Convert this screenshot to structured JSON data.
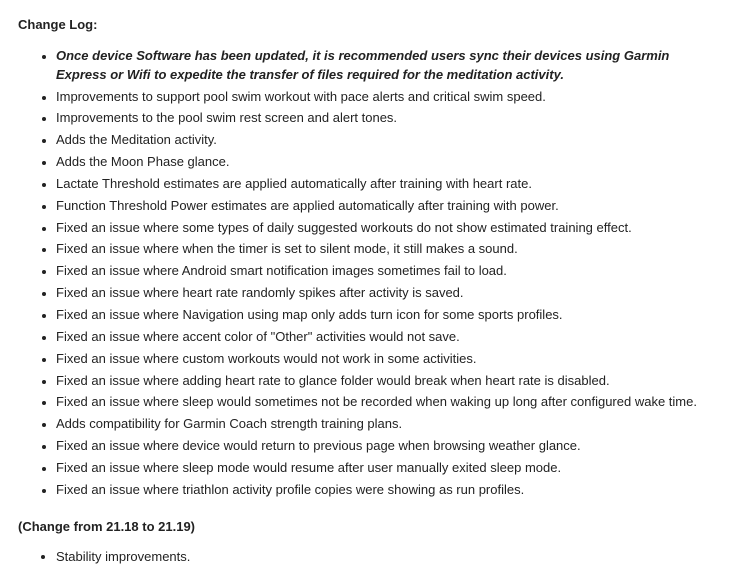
{
  "heading": "Change Log:",
  "items": [
    "Once device Software has been updated, it is recommended users sync their devices using Garmin Express or Wifi to expedite the transfer of files required for the meditation activity.",
    "Improvements to support pool swim workout with pace alerts and critical swim speed.",
    "Improvements to the pool swim rest screen and alert tones.",
    "Adds the Meditation activity.",
    "Adds the Moon Phase glance.",
    "Lactate Threshold estimates are applied automatically after training with heart rate.",
    "Function Threshold Power estimates are applied automatically after training with power.",
    "Fixed an issue where some types of daily suggested workouts do not show estimated training effect.",
    "Fixed an issue where when the timer is set to silent mode, it still makes a sound.",
    "Fixed an issue where Android smart notification images sometimes fail to load.",
    "Fixed an issue where heart rate randomly spikes after activity is saved.",
    "Fixed an issue where Navigation using map only adds turn icon for some sports profiles.",
    "Fixed an issue where accent color of \"Other\" activities would not save.",
    "Fixed an issue where custom workouts would not work in some activities.",
    "Fixed an issue where adding heart rate to glance folder would break when heart rate is disabled.",
    "Fixed an issue where sleep would sometimes not be recorded when waking up long after configured wake time.",
    "Adds compatibility for Garmin Coach strength training plans.",
    "Fixed an issue where device would return to previous page when browsing weather glance.",
    "Fixed an issue where sleep mode would resume after user manually exited sleep mode.",
    "Fixed an issue where triathlon activity profile copies were showing as run profiles."
  ],
  "subheading": "(Change from 21.18 to 21.19)",
  "sub_items": [
    "Stability improvements."
  ]
}
